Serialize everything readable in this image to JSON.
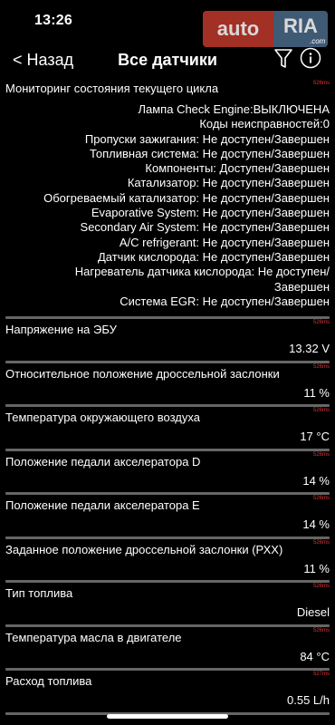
{
  "status": {
    "time": "13:26"
  },
  "watermark": {
    "auto": "auto",
    "ria": "RIA",
    "com": ".com"
  },
  "nav": {
    "back_label": "< Назад",
    "title": "Все датчики",
    "filter_icon": "filter-icon",
    "info_icon": "info-icon"
  },
  "monitor": {
    "title": "Мониторинг состояния текущего цикла",
    "timing": "526ms",
    "lines": [
      "Лампа Check Engine:ВЫКЛЮЧЕНА",
      "Коды неисправностей:0",
      "Пропуски зажигания: Не доступен/Завершен",
      "Топливная система: Не доступен/Завершен",
      "Компоненты: Доступен/Завершен",
      "Катализатор: Не доступен/Завершен",
      "Обогреваемый катализатор: Не доступен/Завершен",
      "Evaporative System: Не доступен/Завершен",
      "Secondary Air System: Не доступен/Завершен",
      "A/C refrigerant: Не доступен/Завершен",
      "Датчик кислорода: Не доступен/Завершен",
      "Нагреватель датчика кислорода: Не доступен/",
      "Завершен",
      "Система EGR: Не доступен/Завершен"
    ]
  },
  "sensors": [
    {
      "label": "Напряжение на ЭБУ",
      "value": "13.32 V",
      "timing": "526ms"
    },
    {
      "label": "Относительное положение дроссельной заслонки",
      "value": "11 %",
      "timing": "526ms"
    },
    {
      "label": "Температура окружающего воздуха",
      "value": "17 °C",
      "timing": "526ms"
    },
    {
      "label": "Положение педали акселератора D",
      "value": "14 %",
      "timing": "526ms"
    },
    {
      "label": "Положение педали акселератора E",
      "value": "14 %",
      "timing": "526ms"
    },
    {
      "label": "Заданное положение дроссельной заслонки (РХХ)",
      "value": "11 %",
      "timing": "526ms"
    },
    {
      "label": "Тип топлива",
      "value": "Diesel",
      "timing": "526ms"
    },
    {
      "label": "Температура масла в двигателе",
      "value": "84 °C",
      "timing": "526ms"
    },
    {
      "label": "Расход топлива",
      "value": "0.55 L/h",
      "timing": "527ms"
    }
  ]
}
